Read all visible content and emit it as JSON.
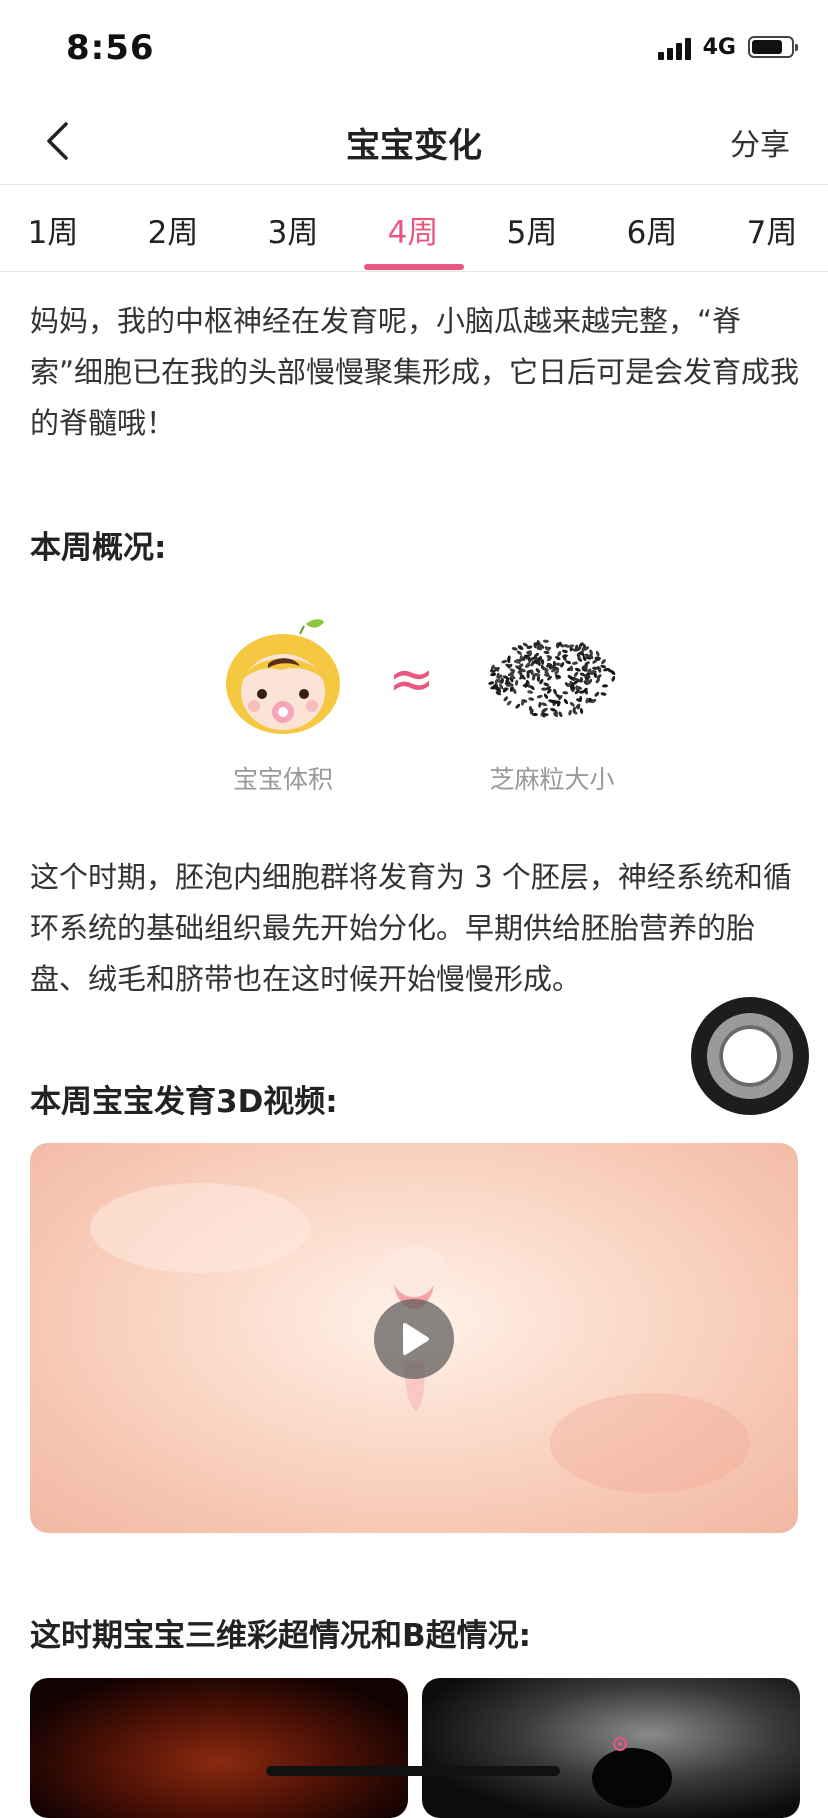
{
  "status_bar": {
    "time": "8:56",
    "network": "4G",
    "battery_level": 0.8
  },
  "nav": {
    "title": "宝宝变化",
    "share": "分享"
  },
  "weeks": {
    "tabs": [
      "1周",
      "2周",
      "3周",
      "4周",
      "5周",
      "6周",
      "7周"
    ],
    "active": "4周"
  },
  "intro_text": "妈妈，我的中枢神经在发育呢，小脑瓜越来越完整，“脊索”细胞已在我的头部慢慢聚集形成，它日后可是会发育成我的脊髓哦！",
  "overview": {
    "title": "本周概况:",
    "baby_label": "宝宝体积",
    "approx_symbol": "≈",
    "compare_label": "芝麻粒大小"
  },
  "description_text": "这个时期，胚泡内细胞群将发育为 3 个胚层，神经系统和循环系统的基础组织最先开始分化。早期供给胚胎营养的胎盘、绒毛和脐带也在这时候开始慢慢形成。",
  "video_section": {
    "title": "本周宝宝发育3D视频:"
  },
  "ultrasound_section": {
    "title": "这时期宝宝三维彩超情况和B超情况:"
  },
  "colors": {
    "accent": "#e8577f",
    "text": "#333333",
    "muted": "#999999"
  },
  "icons": [
    "back-chevron-icon",
    "baby-face-icon",
    "sesame-seeds-icon",
    "play-icon",
    "assistive-touch-icon"
  ]
}
